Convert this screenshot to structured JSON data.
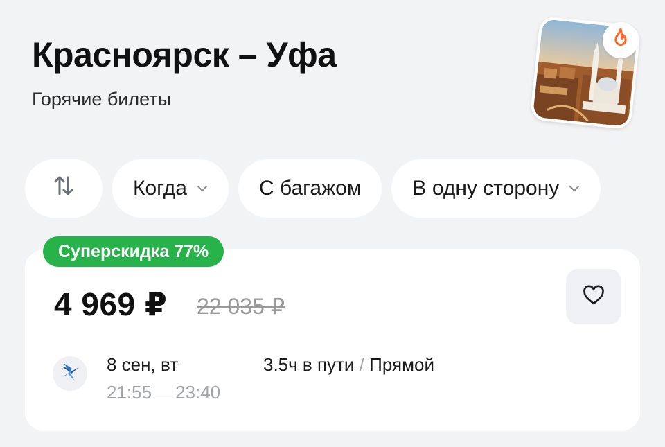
{
  "header": {
    "title": "Красноярск – Уфа",
    "subtitle": "Горячие билеты"
  },
  "filters": {
    "when_label": "Когда",
    "baggage_label": "С багажом",
    "direction_label": "В одну сторону"
  },
  "offer": {
    "discount_badge": "Суперскидка 77%",
    "price": "4 969 ₽",
    "old_price": "22 035 ₽",
    "date": "8 сен, вт",
    "depart_time": "21:55",
    "arrive_time": "23:40",
    "duration": "3.5ч в пути",
    "separator": "/",
    "stops": "Прямой"
  },
  "icons": {
    "swap": "swap-arrows-icon",
    "chevron": "chevron-down-icon",
    "favorite": "heart-icon",
    "hot": "fire-icon",
    "airline": "airline-logo-icon"
  },
  "colors": {
    "badge": "#27b24a",
    "fire": "#ff6a2a",
    "background": "#f2f3f5"
  }
}
